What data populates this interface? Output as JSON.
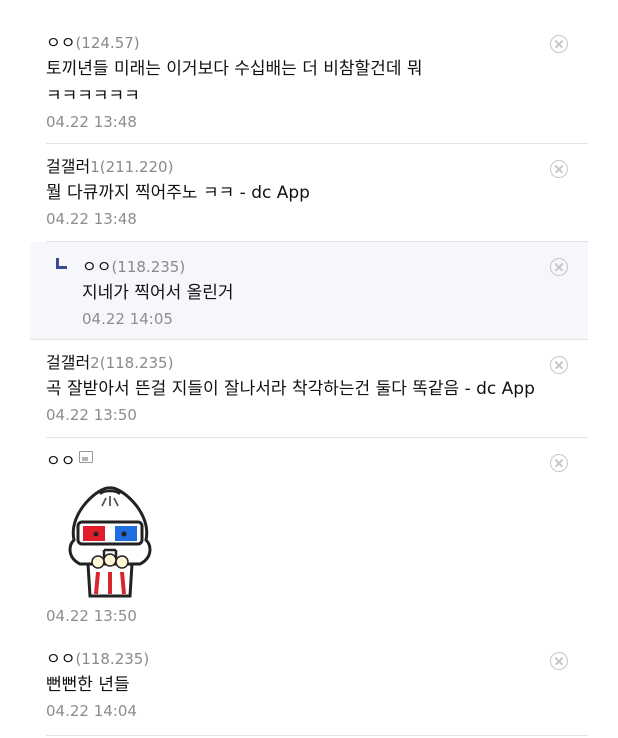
{
  "comments": [
    {
      "nick": "ㅇㅇ",
      "ip": "(124.57)",
      "text_line1": "토끼년들 미래는 이거보다 수십배는 더 비참할건데 뭐",
      "text_line2": "ㅋㅋㅋㅋㅋㅋ",
      "date": "04.22 13:48"
    },
    {
      "nick": "걸갤러",
      "ip": "1(211.220)",
      "text": "뭘 다큐까지 찍어주노 ㅋㅋ - dc App",
      "date": "04.22 13:48"
    },
    {
      "nick": "ㅇㅇ",
      "ip": "(118.235)",
      "text": "지네가 찍어서 올린거",
      "date": "04.22 14:05"
    },
    {
      "nick": "걸갤러",
      "ip": "2(118.235)",
      "text": "곡 잘받아서 뜬걸 지들이 잘나서라 착각하는건 둘다 똑같음 - dc App",
      "date": "04.22 13:50"
    },
    {
      "nick": "ㅇㅇ",
      "date": "04.22 13:50"
    },
    {
      "nick": "ㅇㅇ",
      "ip": "(118.235)",
      "text": "뻔뻔한 년들",
      "date": "04.22 14:04"
    }
  ],
  "icons": {
    "delete": "close-circle-icon",
    "reply": "reply-arrow-icon",
    "image_attached": "image-icon",
    "dccon": "dumpling-3d-glasses-sticker"
  },
  "colors": {
    "ip": "#8a8a8a",
    "date": "#8d8d8d",
    "reply_bg": "#f6f7fb",
    "divider": "#e2e2e2",
    "reply_arrow": "#3a4a8a"
  }
}
